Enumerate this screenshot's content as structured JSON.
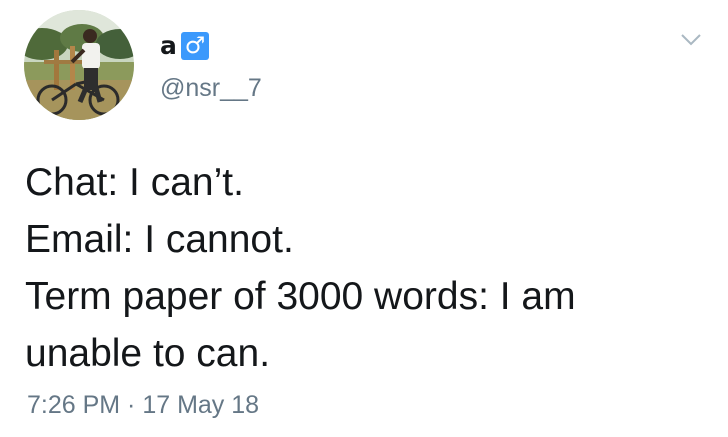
{
  "tweet": {
    "avatar_icon": "profile-photo-man-on-bicycle",
    "display_name": "a",
    "display_name_emoji": "♂",
    "display_name_emoji_icon": "male-sign-icon",
    "handle": "@nsr__7",
    "caret_icon": "chevron-down-icon",
    "text_lines": [
      "Chat: I can’t.",
      "Email: I cannot.",
      "Term paper of 3000 words: I am",
      "unable to can."
    ],
    "timestamp": "7:26 PM · 17 May 18"
  },
  "colors": {
    "text": "#14171a",
    "secondary_text": "#657786",
    "emoji_background": "#3b99fc",
    "background": "#ffffff"
  }
}
